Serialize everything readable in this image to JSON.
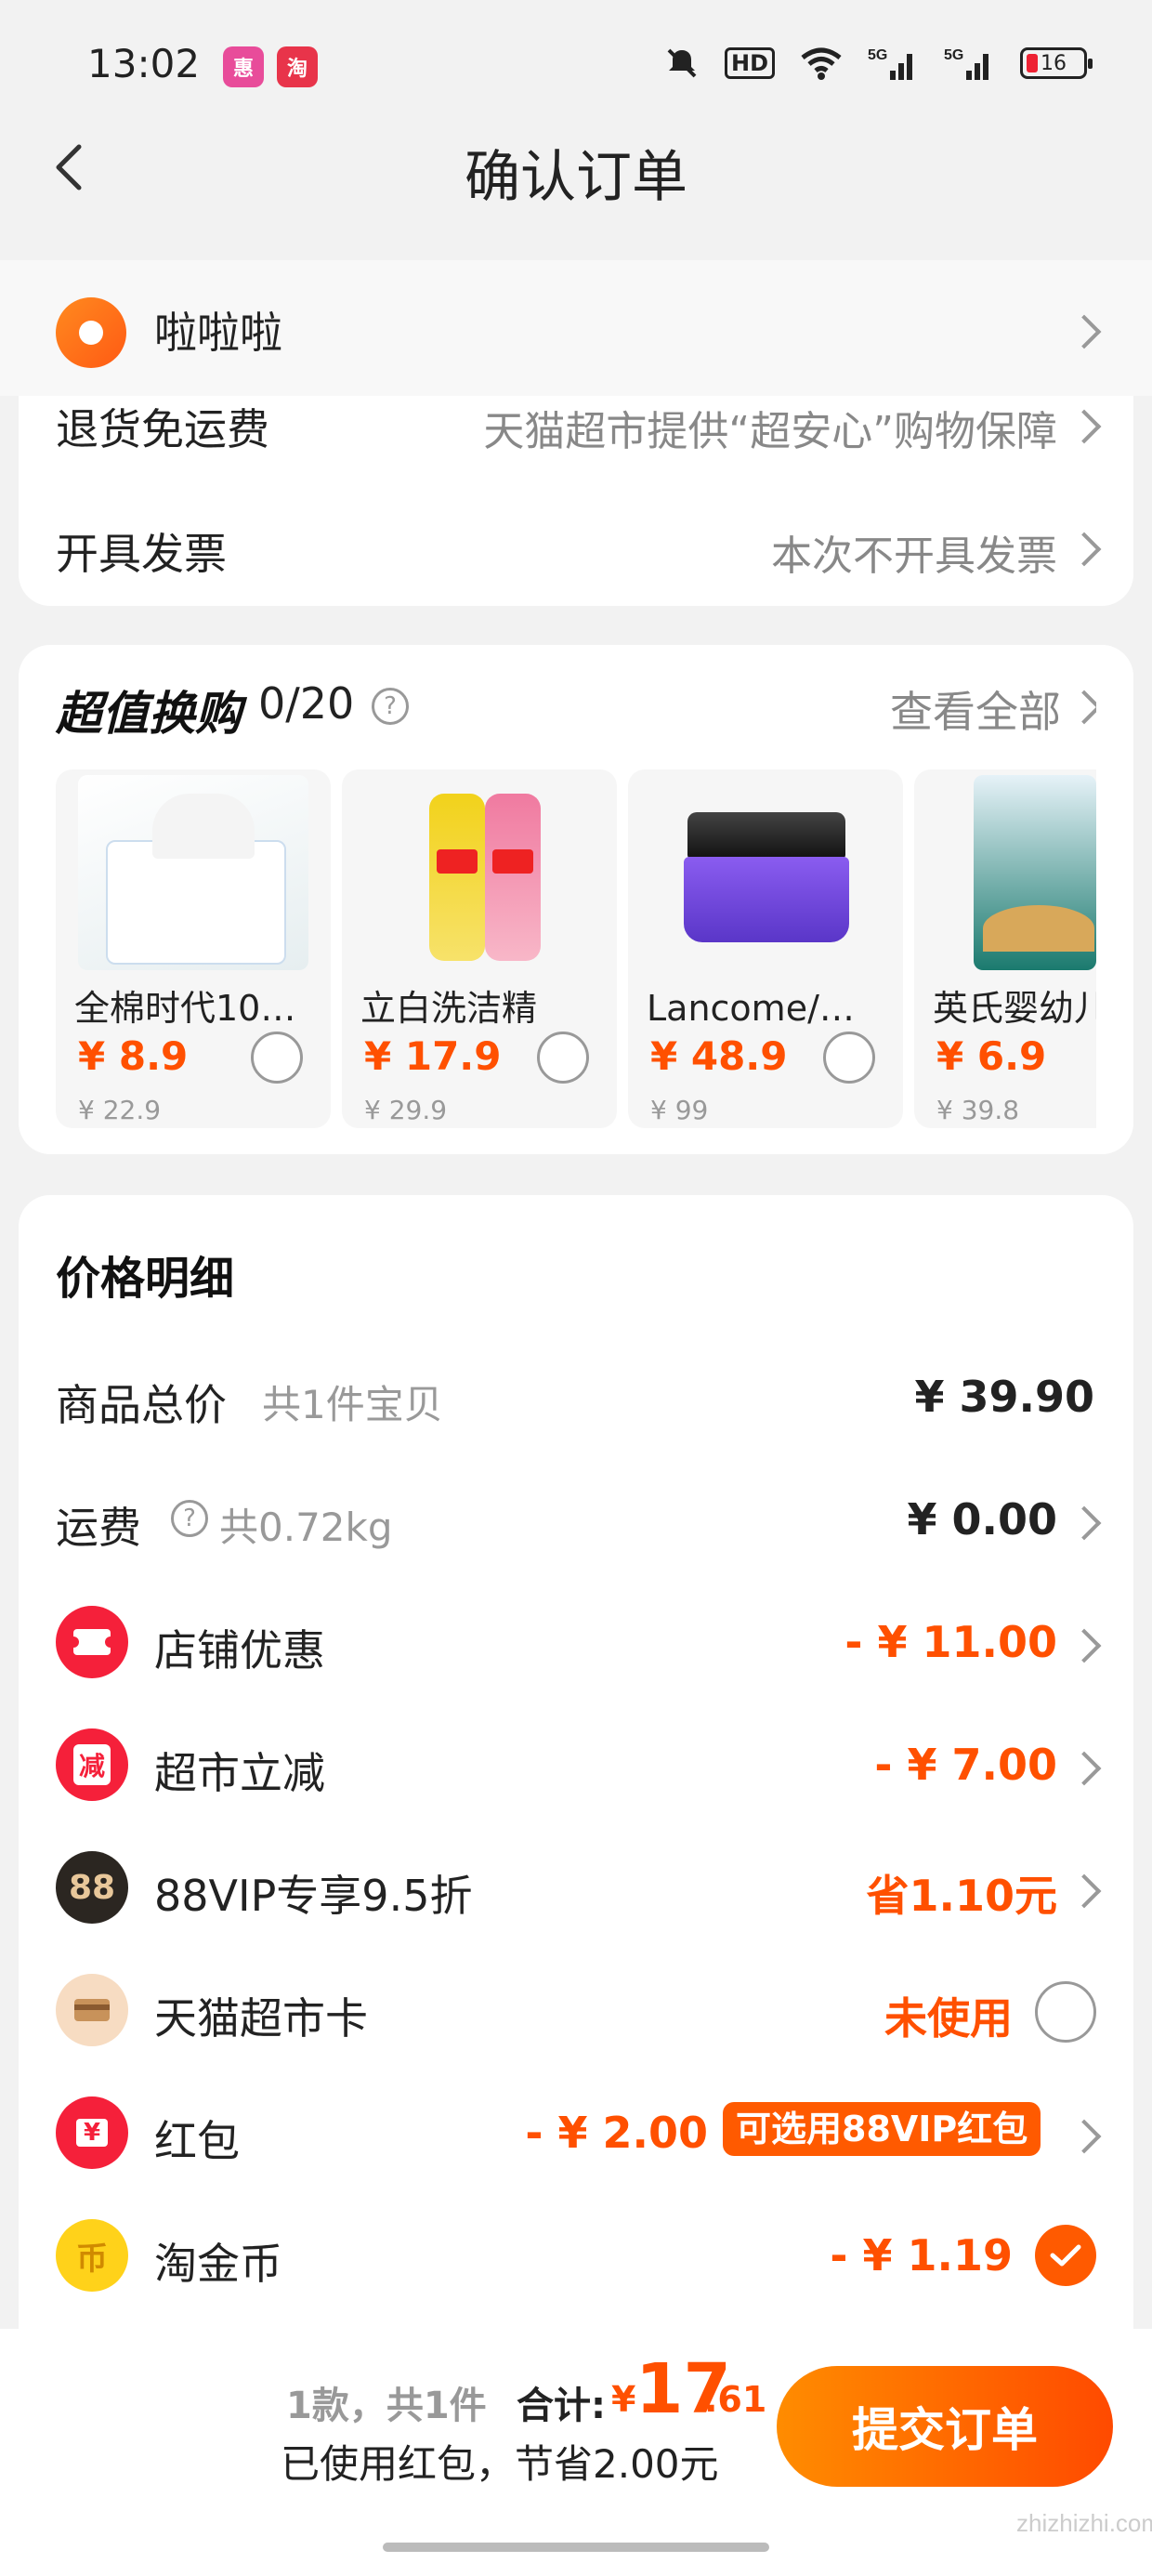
{
  "status": {
    "time": "13:02",
    "right_icons": [
      "mute-icon",
      "hd-icon",
      "wifi-icon",
      "5g-signal-icon",
      "5g-signal-icon"
    ],
    "battery": "16"
  },
  "nav": {
    "title": "确认订单"
  },
  "address": {
    "name": "啦啦啦"
  },
  "service_rows": [
    {
      "label": "退货免运费",
      "value": "天猫超市提供“超安心”购物保障"
    },
    {
      "label": "开具发票",
      "value": "本次不开具发票"
    }
  ],
  "swap": {
    "title": "超值换购",
    "count": "0/20",
    "view_all": "查看全部",
    "products": [
      {
        "name": "全棉时代100...",
        "price": "¥ 8.9",
        "original": "¥ 22.9"
      },
      {
        "name": "立白洗洁精",
        "price": "¥ 17.9",
        "original": "¥ 29.9"
      },
      {
        "name": "Lancome/兰...",
        "price": "¥ 48.9",
        "original": "¥ 99"
      },
      {
        "name": "英氏婴幼儿",
        "price": "¥ 6.9",
        "original": "¥ 39.8"
      }
    ]
  },
  "price_detail": {
    "title": "价格明细",
    "goods_total_label": "商品总价",
    "goods_total_sub": "共1件宝贝",
    "goods_total_value": "¥ 39.90",
    "shipping_label": "运费",
    "shipping_sub": "共0.72kg",
    "shipping_value": "¥ 0.00",
    "items": [
      {
        "label": "店铺优惠",
        "value": "- ¥ 11.00",
        "icon": "ticket-icon"
      },
      {
        "label": "超市立减",
        "value": "- ¥ 7.00",
        "icon": "jian-icon",
        "icon_text": "减"
      },
      {
        "label": "88VIP专享9.5折",
        "value": "省1.10元",
        "icon": "88vip-icon",
        "icon_text": "88"
      },
      {
        "label": "天猫超市卡",
        "value": "未使用",
        "icon": "card-icon"
      },
      {
        "label": "红包",
        "value": "- ¥ 2.00",
        "icon": "red-packet-icon",
        "icon_text": "¥",
        "tag": "可选用88VIP红包"
      },
      {
        "label": "淘金币",
        "value": "- ¥ 1.19",
        "icon": "coin-icon",
        "icon_text": "币"
      }
    ]
  },
  "footer": {
    "count_text": "1款，共1件",
    "total_label": "合计:",
    "currency": "¥",
    "total_int": "17",
    "total_dec": ".61",
    "saved_text": "已使用红包，节省2.00元",
    "submit": "提交订单"
  },
  "colors": {
    "accent": "#ff5000",
    "brand_gradient_start": "#ff8c00",
    "brand_gradient_end": "#ff4a00"
  }
}
